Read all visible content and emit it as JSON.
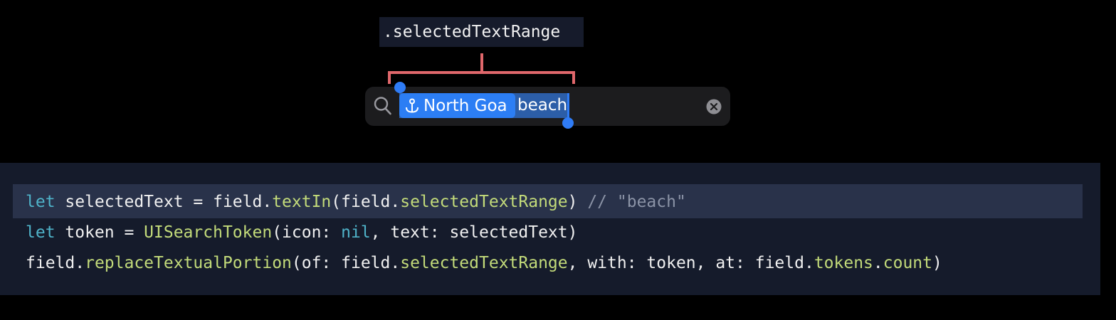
{
  "callout": {
    "label": ".selectedTextRange",
    "bracket_color": "#e0676b"
  },
  "search_field": {
    "token_label": "North Goa",
    "token_icon": "map-pin-icon",
    "text": "beach",
    "search_icon": "search-icon",
    "clear_icon": "clear-icon",
    "accent": "#2c7ef4"
  },
  "code": {
    "lines": [
      [
        {
          "t": "let",
          "c": "kw"
        },
        {
          "t": " selectedText = field.",
          "c": ""
        },
        {
          "t": "textIn",
          "c": "fn"
        },
        {
          "t": "(field.",
          "c": ""
        },
        {
          "t": "selectedTextRange",
          "c": "fn"
        },
        {
          "t": ") ",
          "c": ""
        },
        {
          "t": "// \"beach\"",
          "c": "cm"
        }
      ],
      [
        {
          "t": "let",
          "c": "kw"
        },
        {
          "t": " token = ",
          "c": ""
        },
        {
          "t": "UISearchToken",
          "c": "ty"
        },
        {
          "t": "(icon: ",
          "c": ""
        },
        {
          "t": "nil",
          "c": "kw"
        },
        {
          "t": ", text: selectedText)",
          "c": ""
        }
      ],
      [
        {
          "t": "field.",
          "c": ""
        },
        {
          "t": "replaceTextualPortion",
          "c": "fn"
        },
        {
          "t": "(of: field.",
          "c": ""
        },
        {
          "t": "selectedTextRange",
          "c": "fn"
        },
        {
          "t": ", with: token, at: field.",
          "c": ""
        },
        {
          "t": "tokens",
          "c": "fn"
        },
        {
          "t": ".",
          "c": ""
        },
        {
          "t": "count",
          "c": "fn"
        },
        {
          "t": ")",
          "c": ""
        }
      ]
    ],
    "highlighted_line": 1
  }
}
